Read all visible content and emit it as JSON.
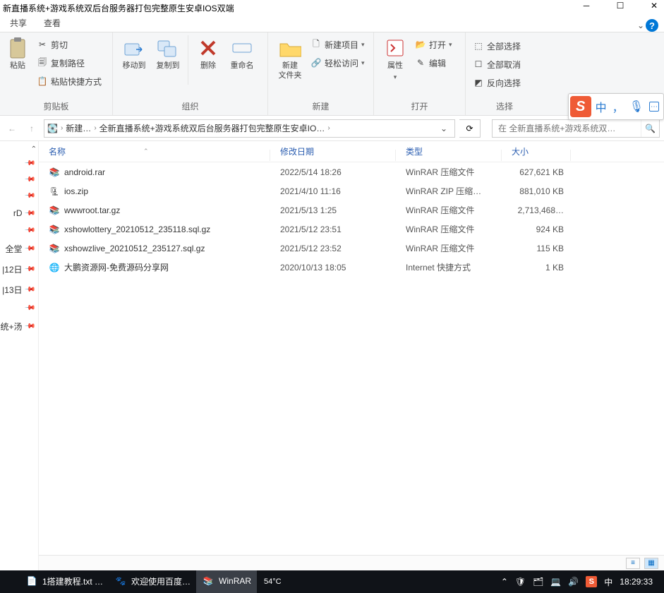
{
  "window": {
    "title": "新直播系统+游戏系统双后台服务器打包完整原生安卓IOS双端",
    "minimize": "─",
    "maximize": "☐",
    "close": "✕"
  },
  "tabs": {
    "share": "共享",
    "view": "查看"
  },
  "ribbon": {
    "clipboard": {
      "paste_big": "粘贴",
      "cut": "剪切",
      "copy_path": "复制路径",
      "paste_shortcut": "粘贴快捷方式",
      "label": "剪贴板"
    },
    "organize": {
      "move_to": "移动到",
      "copy_to": "复制到",
      "delete": "删除",
      "rename": "重命名",
      "label": "组织"
    },
    "new_group": {
      "new_folder": "新建\n文件夹",
      "new_item": "新建项目",
      "easy_access": "轻松访问",
      "label": "新建"
    },
    "open_group": {
      "properties": "属性",
      "open": "打开",
      "edit": "编辑",
      "label": "打开"
    },
    "select_group": {
      "select_all": "全部选择",
      "select_none": "全部取消",
      "invert": "反向选择",
      "label": "选择"
    }
  },
  "ime": {
    "zhong": "中",
    "comma": "，",
    "mic": "🎤"
  },
  "address": {
    "crumb1": "新建…",
    "crumb2": "全新直播系统+游戏系统双后台服务器打包完整原生安卓IO…",
    "search_placeholder": "在 全新直播系统+游戏系统双…"
  },
  "nav": {
    "items": [
      "",
      "",
      "",
      "rD",
      "",
      "全堂",
      "|12日",
      "|13日",
      "",
      "统+汤"
    ]
  },
  "columns": {
    "name": "名称",
    "date": "修改日期",
    "type": "类型",
    "size": "大小"
  },
  "files": [
    {
      "icon": "rar",
      "name": "android.rar",
      "date": "2022/5/14 18:26",
      "type": "WinRAR 压缩文件",
      "size": "627,621 KB"
    },
    {
      "icon": "zip",
      "name": "ios.zip",
      "date": "2021/4/10 11:16",
      "type": "WinRAR ZIP 压缩…",
      "size": "881,010 KB"
    },
    {
      "icon": "rar",
      "name": "wwwroot.tar.gz",
      "date": "2021/5/13 1:25",
      "type": "WinRAR 压缩文件",
      "size": "2,713,468…"
    },
    {
      "icon": "rar",
      "name": "xshowlottery_20210512_235118.sql.gz",
      "date": "2021/5/12 23:51",
      "type": "WinRAR 压缩文件",
      "size": "924 KB"
    },
    {
      "icon": "rar",
      "name": "xshowzlive_20210512_235127.sql.gz",
      "date": "2021/5/12 23:52",
      "type": "WinRAR 压缩文件",
      "size": "115 KB"
    },
    {
      "icon": "url",
      "name": "大鹏资源网-免费源码分享网",
      "date": "2020/10/13 18:05",
      "type": "Internet 快捷方式",
      "size": "1 KB"
    }
  ],
  "taskbar": {
    "item1": "1搭建教程.txt …",
    "item2": "欢迎使用百度…",
    "item3": "WinRAR",
    "weather_temp": "54°C",
    "ime_zhong": "中",
    "clock": "18:29:33"
  }
}
